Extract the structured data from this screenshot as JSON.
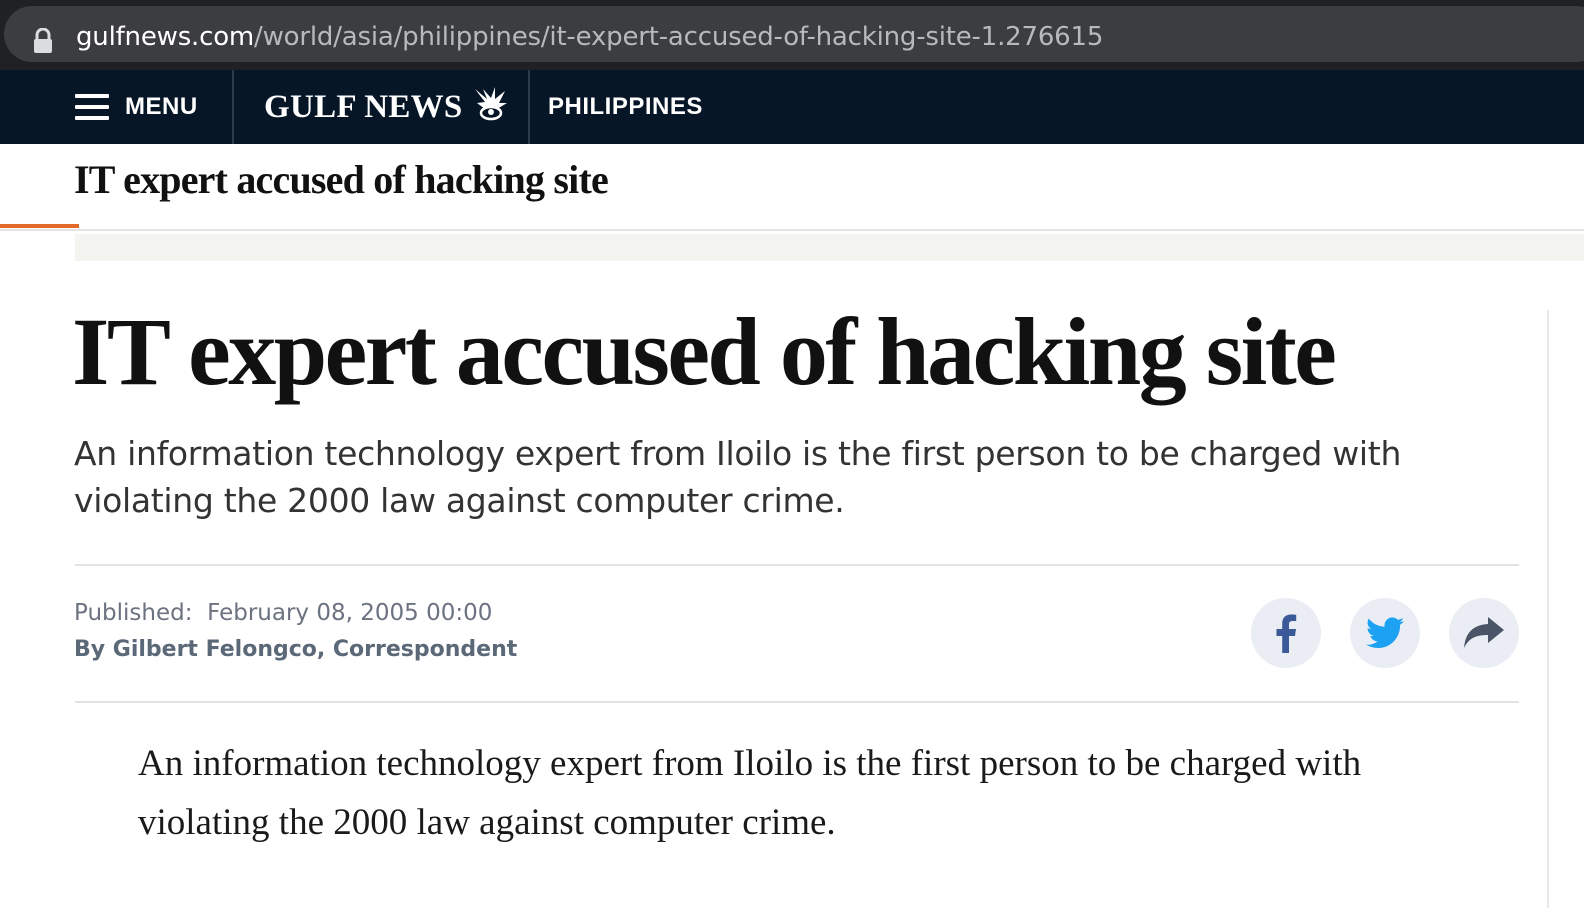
{
  "browser": {
    "url_host": "gulfnews.com",
    "url_path": "/world/asia/philippines/it-expert-accused-of-hacking-site-1.276615"
  },
  "nav": {
    "menu_label": "MENU",
    "logo_text": "GULF NEWS",
    "section_label": "PHILIPPINES"
  },
  "sticky": {
    "title": "IT expert accused of hacking site",
    "read_progress": 0.05
  },
  "article": {
    "headline": "IT expert accused of hacking site",
    "standfirst": "An information technology expert from Iloilo is the first person to be charged with violating the 2000 law against computer crime.",
    "published_label": "Published:",
    "published_date": "February 08, 2005 00:00",
    "byline": "By Gilbert Felongco, Correspondent",
    "body_paragraph_1": "An information technology expert from Iloilo is the first person to be charged with violating the 2000 law against computer crime."
  },
  "share": {
    "items": [
      {
        "name": "facebook-icon",
        "color": "#3b5998"
      },
      {
        "name": "twitter-icon",
        "color": "#1da1f2"
      },
      {
        "name": "share-arrow-icon",
        "color": "#4a5568"
      }
    ]
  },
  "colors": {
    "nav_background": "#071627",
    "accent": "#e36a2b",
    "share_button_bg": "#eaeef4"
  }
}
